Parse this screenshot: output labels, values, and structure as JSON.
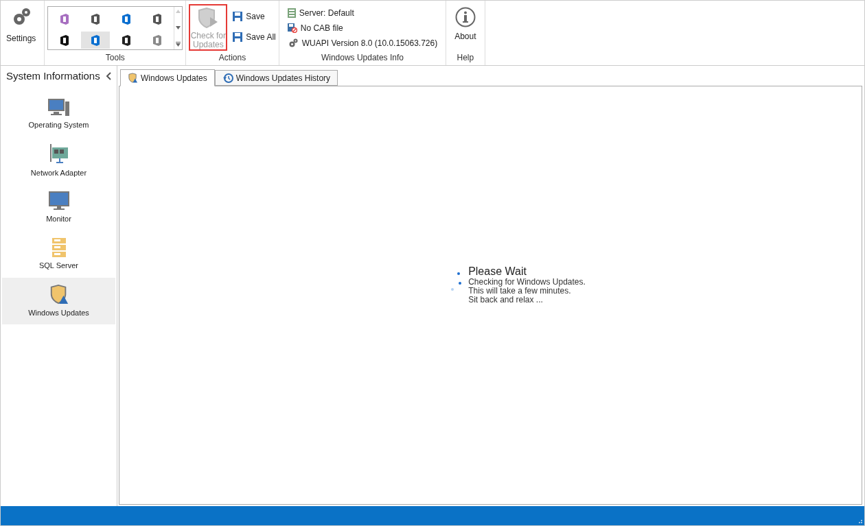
{
  "ribbon": {
    "groups": [
      {
        "kind": "settings",
        "label": "Settings"
      },
      {
        "kind": "gallery",
        "caption": "Tools",
        "items": [
          {
            "color": "#a76fc0",
            "selected": false
          },
          {
            "color": "#555555",
            "selected": false
          },
          {
            "color": "#0a6fd0",
            "selected": false
          },
          {
            "color": "#555555",
            "selected": false
          },
          {
            "color": "#111111",
            "selected": false
          },
          {
            "color": "#0a6fd0",
            "selected": true
          },
          {
            "color": "#222222",
            "selected": false
          },
          {
            "color": "#8a8a8a",
            "selected": false
          }
        ]
      },
      {
        "kind": "actions",
        "caption": "Actions",
        "check": {
          "label": "Check for Updates",
          "disabled": true,
          "highlighted": true
        },
        "buttons": [
          "Save",
          "Save All"
        ]
      },
      {
        "kind": "info",
        "caption": "Windows Updates Info",
        "lines": [
          "Server: Default",
          "No CAB file",
          "WUAPI Version 8.0 (10.0.15063.726)"
        ]
      },
      {
        "kind": "help",
        "caption": "Help",
        "label": "About"
      }
    ]
  },
  "sidebar": {
    "title": "System Informations",
    "items": [
      {
        "kind": "computer",
        "label": "Operating System",
        "selected": false
      },
      {
        "kind": "network",
        "label": "Network Adapter",
        "selected": false
      },
      {
        "kind": "monitor",
        "label": "Monitor",
        "selected": false
      },
      {
        "kind": "sql",
        "label": "SQL Server",
        "selected": false
      },
      {
        "kind": "shield",
        "label": "Windows Updates",
        "selected": true
      }
    ]
  },
  "tabs": [
    {
      "kind": "shield",
      "label": "Windows Updates",
      "selected": true
    },
    {
      "kind": "history",
      "label": "Windows Updates History",
      "selected": false
    }
  ],
  "wait": {
    "title": "Please Wait",
    "lines": [
      "Checking for Windows Updates.",
      "This will take a few minutes.",
      "Sit back and relax ..."
    ]
  }
}
